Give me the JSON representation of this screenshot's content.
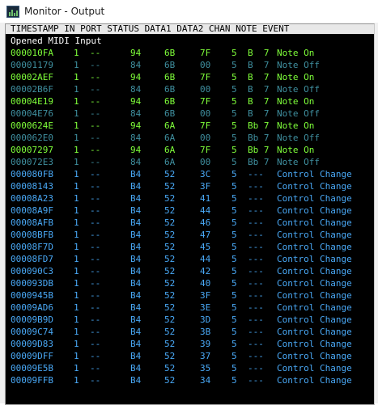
{
  "window": {
    "title": "Monitor - Output"
  },
  "header": {
    "text": "TIMESTAMP IN PORT STATUS DATA1 DATA2 CHAN NOTE EVENT"
  },
  "message": "Opened MIDI Input",
  "colors": {
    "note_on": "#7fff3a",
    "note_off": "#3f8f9f",
    "control_change": "#49a8f5",
    "background": "#000000",
    "header_bg": "#e8e8e8"
  },
  "rows": [
    {
      "ts": "000010FA",
      "in": "1",
      "port": "--",
      "status": "94",
      "d1": "6B",
      "d2": "7F",
      "chan": "5",
      "note": "B  7",
      "event": "Note On",
      "kind": "note_on"
    },
    {
      "ts": "00001179",
      "in": "1",
      "port": "--",
      "status": "84",
      "d1": "6B",
      "d2": "00",
      "chan": "5",
      "note": "B  7",
      "event": "Note Off",
      "kind": "note_off"
    },
    {
      "ts": "00002AEF",
      "in": "1",
      "port": "--",
      "status": "94",
      "d1": "6B",
      "d2": "7F",
      "chan": "5",
      "note": "B  7",
      "event": "Note On",
      "kind": "note_on"
    },
    {
      "ts": "00002B6F",
      "in": "1",
      "port": "--",
      "status": "84",
      "d1": "6B",
      "d2": "00",
      "chan": "5",
      "note": "B  7",
      "event": "Note Off",
      "kind": "note_off"
    },
    {
      "ts": "00004E19",
      "in": "1",
      "port": "--",
      "status": "94",
      "d1": "6B",
      "d2": "7F",
      "chan": "5",
      "note": "B  7",
      "event": "Note On",
      "kind": "note_on"
    },
    {
      "ts": "00004E76",
      "in": "1",
      "port": "--",
      "status": "84",
      "d1": "6B",
      "d2": "00",
      "chan": "5",
      "note": "B  7",
      "event": "Note Off",
      "kind": "note_off"
    },
    {
      "ts": "0000624E",
      "in": "1",
      "port": "--",
      "status": "94",
      "d1": "6A",
      "d2": "7F",
      "chan": "5",
      "note": "Bb 7",
      "event": "Note On",
      "kind": "note_on"
    },
    {
      "ts": "000062E0",
      "in": "1",
      "port": "--",
      "status": "84",
      "d1": "6A",
      "d2": "00",
      "chan": "5",
      "note": "Bb 7",
      "event": "Note Off",
      "kind": "note_off"
    },
    {
      "ts": "00007297",
      "in": "1",
      "port": "--",
      "status": "94",
      "d1": "6A",
      "d2": "7F",
      "chan": "5",
      "note": "Bb 7",
      "event": "Note On",
      "kind": "note_on"
    },
    {
      "ts": "000072E3",
      "in": "1",
      "port": "--",
      "status": "84",
      "d1": "6A",
      "d2": "00",
      "chan": "5",
      "note": "Bb 7",
      "event": "Note Off",
      "kind": "note_off"
    },
    {
      "ts": "000080FB",
      "in": "1",
      "port": "--",
      "status": "B4",
      "d1": "52",
      "d2": "3C",
      "chan": "5",
      "note": "---",
      "event": "Control Change",
      "kind": "control_change"
    },
    {
      "ts": "00008143",
      "in": "1",
      "port": "--",
      "status": "B4",
      "d1": "52",
      "d2": "3F",
      "chan": "5",
      "note": "---",
      "event": "Control Change",
      "kind": "control_change"
    },
    {
      "ts": "00008A23",
      "in": "1",
      "port": "--",
      "status": "B4",
      "d1": "52",
      "d2": "41",
      "chan": "5",
      "note": "---",
      "event": "Control Change",
      "kind": "control_change"
    },
    {
      "ts": "00008A9F",
      "in": "1",
      "port": "--",
      "status": "B4",
      "d1": "52",
      "d2": "44",
      "chan": "5",
      "note": "---",
      "event": "Control Change",
      "kind": "control_change"
    },
    {
      "ts": "00008AFB",
      "in": "1",
      "port": "--",
      "status": "B4",
      "d1": "52",
      "d2": "46",
      "chan": "5",
      "note": "---",
      "event": "Control Change",
      "kind": "control_change"
    },
    {
      "ts": "00008BFB",
      "in": "1",
      "port": "--",
      "status": "B4",
      "d1": "52",
      "d2": "47",
      "chan": "5",
      "note": "---",
      "event": "Control Change",
      "kind": "control_change"
    },
    {
      "ts": "00008F7D",
      "in": "1",
      "port": "--",
      "status": "B4",
      "d1": "52",
      "d2": "45",
      "chan": "5",
      "note": "---",
      "event": "Control Change",
      "kind": "control_change"
    },
    {
      "ts": "00008FD7",
      "in": "1",
      "port": "--",
      "status": "B4",
      "d1": "52",
      "d2": "44",
      "chan": "5",
      "note": "---",
      "event": "Control Change",
      "kind": "control_change"
    },
    {
      "ts": "000090C3",
      "in": "1",
      "port": "--",
      "status": "B4",
      "d1": "52",
      "d2": "42",
      "chan": "5",
      "note": "---",
      "event": "Control Change",
      "kind": "control_change"
    },
    {
      "ts": "000093DB",
      "in": "1",
      "port": "--",
      "status": "B4",
      "d1": "52",
      "d2": "40",
      "chan": "5",
      "note": "---",
      "event": "Control Change",
      "kind": "control_change"
    },
    {
      "ts": "0000945B",
      "in": "1",
      "port": "--",
      "status": "B4",
      "d1": "52",
      "d2": "3F",
      "chan": "5",
      "note": "---",
      "event": "Control Change",
      "kind": "control_change"
    },
    {
      "ts": "00009AD6",
      "in": "1",
      "port": "--",
      "status": "B4",
      "d1": "52",
      "d2": "3E",
      "chan": "5",
      "note": "---",
      "event": "Control Change",
      "kind": "control_change"
    },
    {
      "ts": "00009B9D",
      "in": "1",
      "port": "--",
      "status": "B4",
      "d1": "52",
      "d2": "3D",
      "chan": "5",
      "note": "---",
      "event": "Control Change",
      "kind": "control_change"
    },
    {
      "ts": "00009C74",
      "in": "1",
      "port": "--",
      "status": "B4",
      "d1": "52",
      "d2": "3B",
      "chan": "5",
      "note": "---",
      "event": "Control Change",
      "kind": "control_change"
    },
    {
      "ts": "00009D83",
      "in": "1",
      "port": "--",
      "status": "B4",
      "d1": "52",
      "d2": "39",
      "chan": "5",
      "note": "---",
      "event": "Control Change",
      "kind": "control_change"
    },
    {
      "ts": "00009DFF",
      "in": "1",
      "port": "--",
      "status": "B4",
      "d1": "52",
      "d2": "37",
      "chan": "5",
      "note": "---",
      "event": "Control Change",
      "kind": "control_change"
    },
    {
      "ts": "00009E5B",
      "in": "1",
      "port": "--",
      "status": "B4",
      "d1": "52",
      "d2": "35",
      "chan": "5",
      "note": "---",
      "event": "Control Change",
      "kind": "control_change"
    },
    {
      "ts": "00009FFB",
      "in": "1",
      "port": "--",
      "status": "B4",
      "d1": "52",
      "d2": "34",
      "chan": "5",
      "note": "---",
      "event": "Control Change",
      "kind": "control_change"
    }
  ]
}
